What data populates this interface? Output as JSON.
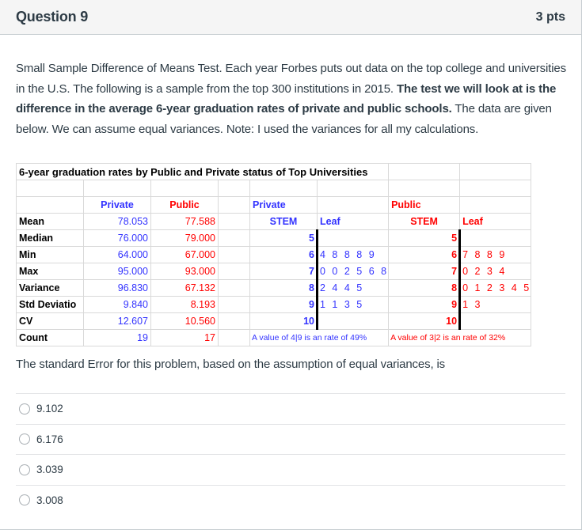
{
  "question": {
    "title": "Question 9",
    "points": "3 pts",
    "text_part1": "Small Sample Difference of Means Test.  Each year Forbes puts out data on the top college and universities in the U.S.  The following is a sample from the top 300 institutions in 2015. ",
    "text_bold": "The test we will look at is the difference in the average 6-year graduation rates of private and public schools.",
    "text_part2": " The data are given below.  We can assume equal variances.  Note: I used the variances for all my calculations.",
    "prompt": "The standard Error for this problem, based on the assumption of equal variances, is"
  },
  "sheet": {
    "title": "6-year graduation rates by Public and Private status of Top Universities",
    "colors": {
      "private": "#3333ff",
      "public": "#ff0000"
    },
    "headers": {
      "private": "Private",
      "public": "Public",
      "stem_private_label": "Private",
      "stem_public_label": "Public",
      "stem": "STEM",
      "leaf": "Leaf"
    },
    "stats": [
      {
        "label": "Mean",
        "private": "78.053",
        "public": "77.588"
      },
      {
        "label": "Median",
        "private": "76.000",
        "public": "79.000"
      },
      {
        "label": "Min",
        "private": "64.000",
        "public": "67.000"
      },
      {
        "label": "Max",
        "private": "95.000",
        "public": "93.000"
      },
      {
        "label": "Variance",
        "private": "96.830",
        "public": "67.132"
      },
      {
        "label": "Std Deviatio",
        "private": "9.840",
        "public": "8.193"
      },
      {
        "label": "CV",
        "private": "12.607",
        "public": "10.560"
      },
      {
        "label": "Count",
        "private": "19",
        "public": "17"
      }
    ],
    "stem_private": [
      {
        "stem": "5",
        "leaf": ""
      },
      {
        "stem": "6",
        "leaf": "4 8 8 8 9"
      },
      {
        "stem": "7",
        "leaf": "0 0 2 5 6 8"
      },
      {
        "stem": "8",
        "leaf": "2 4 4 5"
      },
      {
        "stem": "9",
        "leaf": "1 1 3 5"
      },
      {
        "stem": "10",
        "leaf": ""
      }
    ],
    "stem_public": [
      {
        "stem": "5",
        "leaf": ""
      },
      {
        "stem": "6",
        "leaf": "7 8 8 9"
      },
      {
        "stem": "7",
        "leaf": "0 2 3 4"
      },
      {
        "stem": "8",
        "leaf": "0 1 2 3 4 5"
      },
      {
        "stem": "9",
        "leaf": "1 3"
      },
      {
        "stem": "10",
        "leaf": ""
      }
    ],
    "note_private": "A value of 4|9 is an rate of 49%",
    "note_public": "A value of 3|2 is an rate of 32%"
  },
  "answers": [
    {
      "label": "9.102",
      "selected": false
    },
    {
      "label": "6.176",
      "selected": false
    },
    {
      "label": "3.039",
      "selected": false
    },
    {
      "label": "3.008",
      "selected": false
    }
  ]
}
